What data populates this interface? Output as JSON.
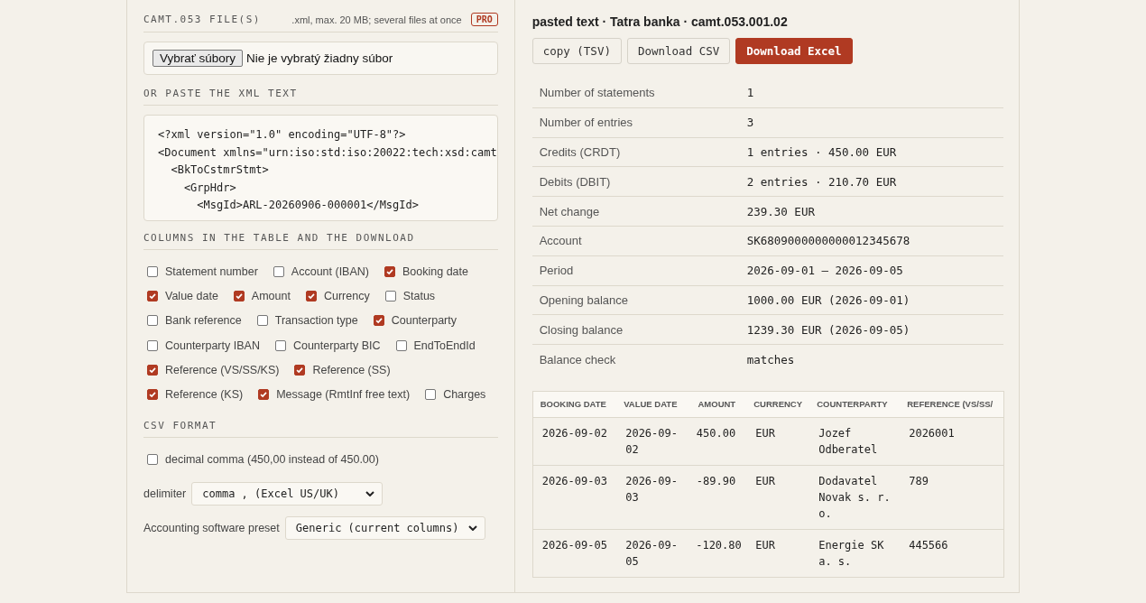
{
  "files": {
    "title": "CAMT.053 FILE(S)",
    "hint": ".xml, max. 20 MB; several files at once",
    "badge": "PRO",
    "choose_button": "Vybrať súbory",
    "no_file": "Nie je vybratý žiadny súbor"
  },
  "paste": {
    "title": "OR PASTE THE XML TEXT",
    "lines": [
      "<?xml version=\"1.0\" encoding=\"UTF-8\"?>",
      "<Document xmlns=\"urn:iso:std:iso:20022:tech:xsd:camt",
      "  <BkToCstmrStmt>",
      "    <GrpHdr>",
      "      <MsgId>ARL-20260906-000001</MsgId>"
    ]
  },
  "columns": {
    "title": "COLUMNS IN THE TABLE AND THE DOWNLOAD",
    "options": [
      {
        "label": "Statement number",
        "checked": false
      },
      {
        "label": "Account (IBAN)",
        "checked": false
      },
      {
        "label": "Booking date",
        "checked": true
      },
      {
        "label": "Value date",
        "checked": true
      },
      {
        "label": "Amount",
        "checked": true
      },
      {
        "label": "Currency",
        "checked": true
      },
      {
        "label": "Status",
        "checked": false
      },
      {
        "label": "Bank reference",
        "checked": false
      },
      {
        "label": "Transaction type",
        "checked": false
      },
      {
        "label": "Counterparty",
        "checked": true
      },
      {
        "label": "Counterparty IBAN",
        "checked": false
      },
      {
        "label": "Counterparty BIC",
        "checked": false
      },
      {
        "label": "EndToEndId",
        "checked": false
      },
      {
        "label": "Reference (VS/SS/KS)",
        "checked": true
      },
      {
        "label": "Reference (SS)",
        "checked": true
      },
      {
        "label": "Reference (KS)",
        "checked": true
      },
      {
        "label": "Message (RmtInf free text)",
        "checked": true
      },
      {
        "label": "Charges",
        "checked": false
      }
    ]
  },
  "csv": {
    "title": "CSV FORMAT",
    "decimal_comma": {
      "label": "decimal comma (450,00 instead of 450.00)",
      "checked": false
    },
    "delimiter": {
      "label": "delimiter",
      "value": "comma , (Excel US/UK)"
    },
    "preset": {
      "label": "Accounting software preset",
      "value": "Generic (current columns)"
    }
  },
  "result": {
    "title": "pasted text · Tatra banka · camt.053.001.02",
    "buttons": [
      {
        "label": "copy (TSV)",
        "kind": "plain"
      },
      {
        "label": "Download CSV",
        "kind": "plain"
      },
      {
        "label": "Download Excel",
        "kind": "primary"
      }
    ],
    "summary": [
      {
        "label": "Number of statements",
        "value": "1"
      },
      {
        "label": "Number of entries",
        "value": "3"
      },
      {
        "label": "Credits (CRDT)",
        "value": "1 entries · 450.00 EUR"
      },
      {
        "label": "Debits (DBIT)",
        "value": "2 entries · 210.70 EUR"
      },
      {
        "label": "Net change",
        "value": "239.30 EUR"
      },
      {
        "label": "Account",
        "value": "SK6809000000000012345678"
      },
      {
        "label": "Period",
        "value": "2026-09-01 – 2026-09-05"
      },
      {
        "label": "Opening balance",
        "value": "1000.00 EUR (2026-09-01)"
      },
      {
        "label": "Closing balance",
        "value": "1239.30 EUR (2026-09-05)"
      },
      {
        "label": "Balance check",
        "value": "matches"
      }
    ],
    "table": {
      "columns": [
        "BOOKING DATE",
        "VALUE DATE",
        "AMOUNT",
        "CURRENCY",
        "COUNTERPARTY",
        "REFERENCE (VS/SS/"
      ],
      "rows": [
        [
          "2026-09-02",
          "2026-09-02",
          "450.00",
          "EUR",
          "Jozef Odberatel",
          "2026001"
        ],
        [
          "2026-09-03",
          "2026-09-03",
          "-89.90",
          "EUR",
          "Dodavatel Novak s. r. o.",
          "789"
        ],
        [
          "2026-09-05",
          "2026-09-05",
          "-120.80",
          "EUR",
          "Energie SK a. s.",
          "445566"
        ]
      ]
    }
  }
}
